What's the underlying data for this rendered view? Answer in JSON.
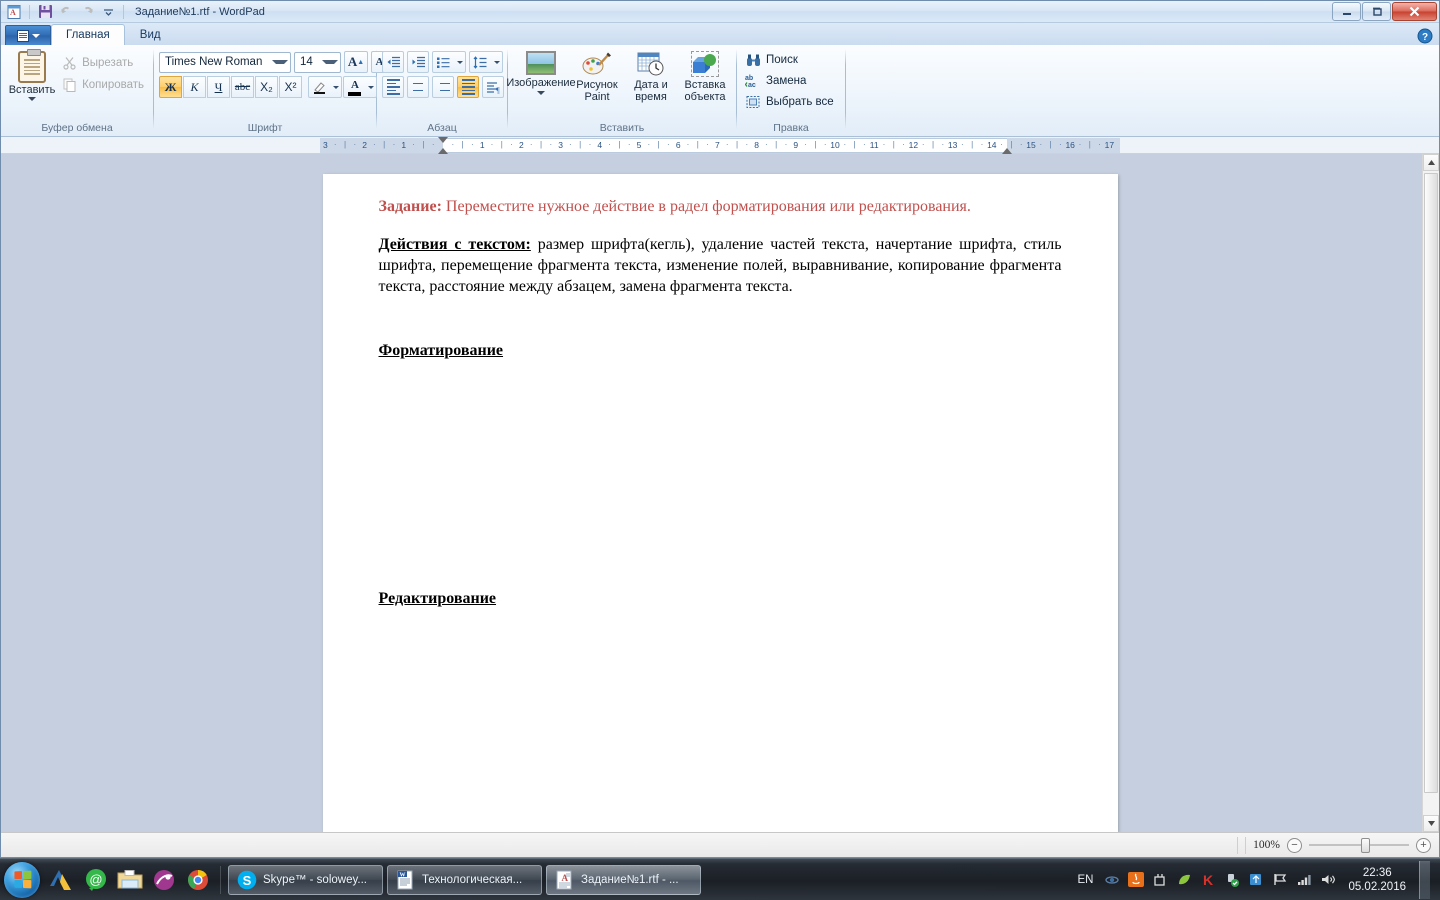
{
  "window": {
    "title": "ЗаданиеNo1.rtf - WordPad",
    "title_display": "Задание№1.rtf - WordPad",
    "quick_access": [
      {
        "name": "wordpad-app-icon",
        "glyph": "A"
      },
      {
        "name": "save-icon",
        "glyph": "save"
      },
      {
        "name": "undo-icon",
        "glyph": "undo"
      },
      {
        "name": "redo-icon",
        "glyph": "redo"
      },
      {
        "name": "customize-qat-icon",
        "glyph": "caret"
      }
    ],
    "controls": {
      "minimize": "–",
      "maximize": "❐",
      "close": "✕"
    },
    "help_label": "?"
  },
  "tabs": {
    "app_button_label": "",
    "items": [
      {
        "label": "Главная",
        "active": true
      },
      {
        "label": "Вид",
        "active": false
      }
    ]
  },
  "ribbon": {
    "groups": [
      {
        "name": "clipboard",
        "label": "Буфер обмена",
        "paste_label": "Вставить",
        "items": [
          {
            "label": "Вырезать",
            "icon": "scissors-icon",
            "disabled": true
          },
          {
            "label": "Копировать",
            "icon": "copy-icon",
            "disabled": true
          }
        ]
      },
      {
        "name": "font",
        "label": "Шрифт",
        "font_family_value": "Times New Roman",
        "font_size_value": "14",
        "grow_font_label": "A",
        "shrink_font_label": "A",
        "buttons": [
          {
            "label": "Ж",
            "name": "bold-button",
            "active": true
          },
          {
            "label": "К",
            "name": "italic-button",
            "active": false
          },
          {
            "label": "Ч",
            "name": "underline-button",
            "active": false
          },
          {
            "label": "abc",
            "name": "strikethrough-button",
            "active": false
          },
          {
            "label": "X₂",
            "name": "subscript-button",
            "active": false
          },
          {
            "label": "X²",
            "name": "superscript-button",
            "active": false
          }
        ],
        "highlight_name": "text-highlight-button",
        "textcolor_name": "font-color-button",
        "text_color": "#000000"
      },
      {
        "name": "paragraph",
        "label": "Абзац",
        "buttons": [
          {
            "name": "decrease-indent-button"
          },
          {
            "name": "increase-indent-button"
          },
          {
            "name": "bullets-button"
          },
          {
            "name": "line-spacing-button"
          },
          {
            "name": "align-left-button",
            "active": false
          },
          {
            "name": "align-center-button",
            "active": false
          },
          {
            "name": "align-right-button",
            "active": false
          },
          {
            "name": "align-justify-button",
            "active": true
          },
          {
            "name": "paragraph-settings-button",
            "active": false
          }
        ]
      },
      {
        "name": "insert",
        "label": "Вставить",
        "items": [
          {
            "label": "Изображение",
            "icon": "picture-icon",
            "has_dropdown": true
          },
          {
            "label": "Рисунок Paint",
            "icon": "paint-drawing-icon",
            "has_dropdown": false
          },
          {
            "label": "Дата и время",
            "icon": "date-time-icon",
            "has_dropdown": false
          },
          {
            "label": "Вставка объекта",
            "icon": "insert-object-icon",
            "has_dropdown": false
          }
        ]
      },
      {
        "name": "editing",
        "label": "Правка",
        "items": [
          {
            "label": "Поиск",
            "icon": "binoculars-icon"
          },
          {
            "label": "Замена",
            "icon": "replace-icon"
          },
          {
            "label": "Выбрать все",
            "icon": "select-all-icon"
          }
        ]
      }
    ]
  },
  "ruler": {
    "left_numbers": [
      "3",
      "2",
      "1"
    ],
    "right_numbers": [
      "1",
      "2",
      "3",
      "4",
      "5",
      "6",
      "7",
      "8",
      "9",
      "10",
      "11",
      "12",
      "13",
      "14",
      "15",
      "16",
      "17"
    ]
  },
  "document": {
    "paragraphs": [
      {
        "name": "task-paragraph",
        "color": "#c0504d",
        "bold_lead": "Задание:",
        "text": " Переместите нужное действие в радел форматирования или редактирования."
      },
      {
        "name": "actions-paragraph",
        "color": "#000000",
        "bold_lead": "Действия с текстом:",
        "text": " размер шрифта(кегль), удаление частей текста, начертание шрифта, стиль шрифта, перемещение фрагмента текста, изменение полей, выравнивание, копирование фрагмента текста, расстояние между абзацем, замена фрагмента текста."
      }
    ],
    "heading_formatting": "Форматирование",
    "heading_editing": "Редактирование"
  },
  "statusbar": {
    "zoom_label": "100%",
    "zoom_out": "−",
    "zoom_in": "+"
  },
  "taskbar": {
    "start_label": "",
    "quick_launch": [
      {
        "name": "autocad-icon"
      },
      {
        "name": "mail-agent-icon"
      },
      {
        "name": "explorer-icon"
      },
      {
        "name": "media-player-icon"
      },
      {
        "name": "chrome-icon"
      }
    ],
    "items": [
      {
        "name": "taskbar-item-skype",
        "label": "Skype™ - solowey...",
        "icon": "skype-icon"
      },
      {
        "name": "taskbar-item-word",
        "label": "Технологическая...",
        "icon": "word-icon"
      },
      {
        "name": "taskbar-item-wordpad",
        "label": "Задание№1.rtf - ...",
        "icon": "wordpad-icon",
        "active": true
      }
    ],
    "tray": {
      "language": "EN",
      "icons": [
        {
          "name": "tray-show-hidden-icon"
        },
        {
          "name": "java-icon"
        },
        {
          "name": "safely-remove-hardware-icon"
        },
        {
          "name": "green-leaf-icon"
        },
        {
          "name": "kaspersky-icon"
        },
        {
          "name": "usb-device-icon"
        },
        {
          "name": "windows-update-icon"
        },
        {
          "name": "action-center-flag-icon"
        },
        {
          "name": "network-signal-icon"
        },
        {
          "name": "volume-icon"
        }
      ],
      "time": "22:36",
      "date": "05.02.2016"
    }
  }
}
